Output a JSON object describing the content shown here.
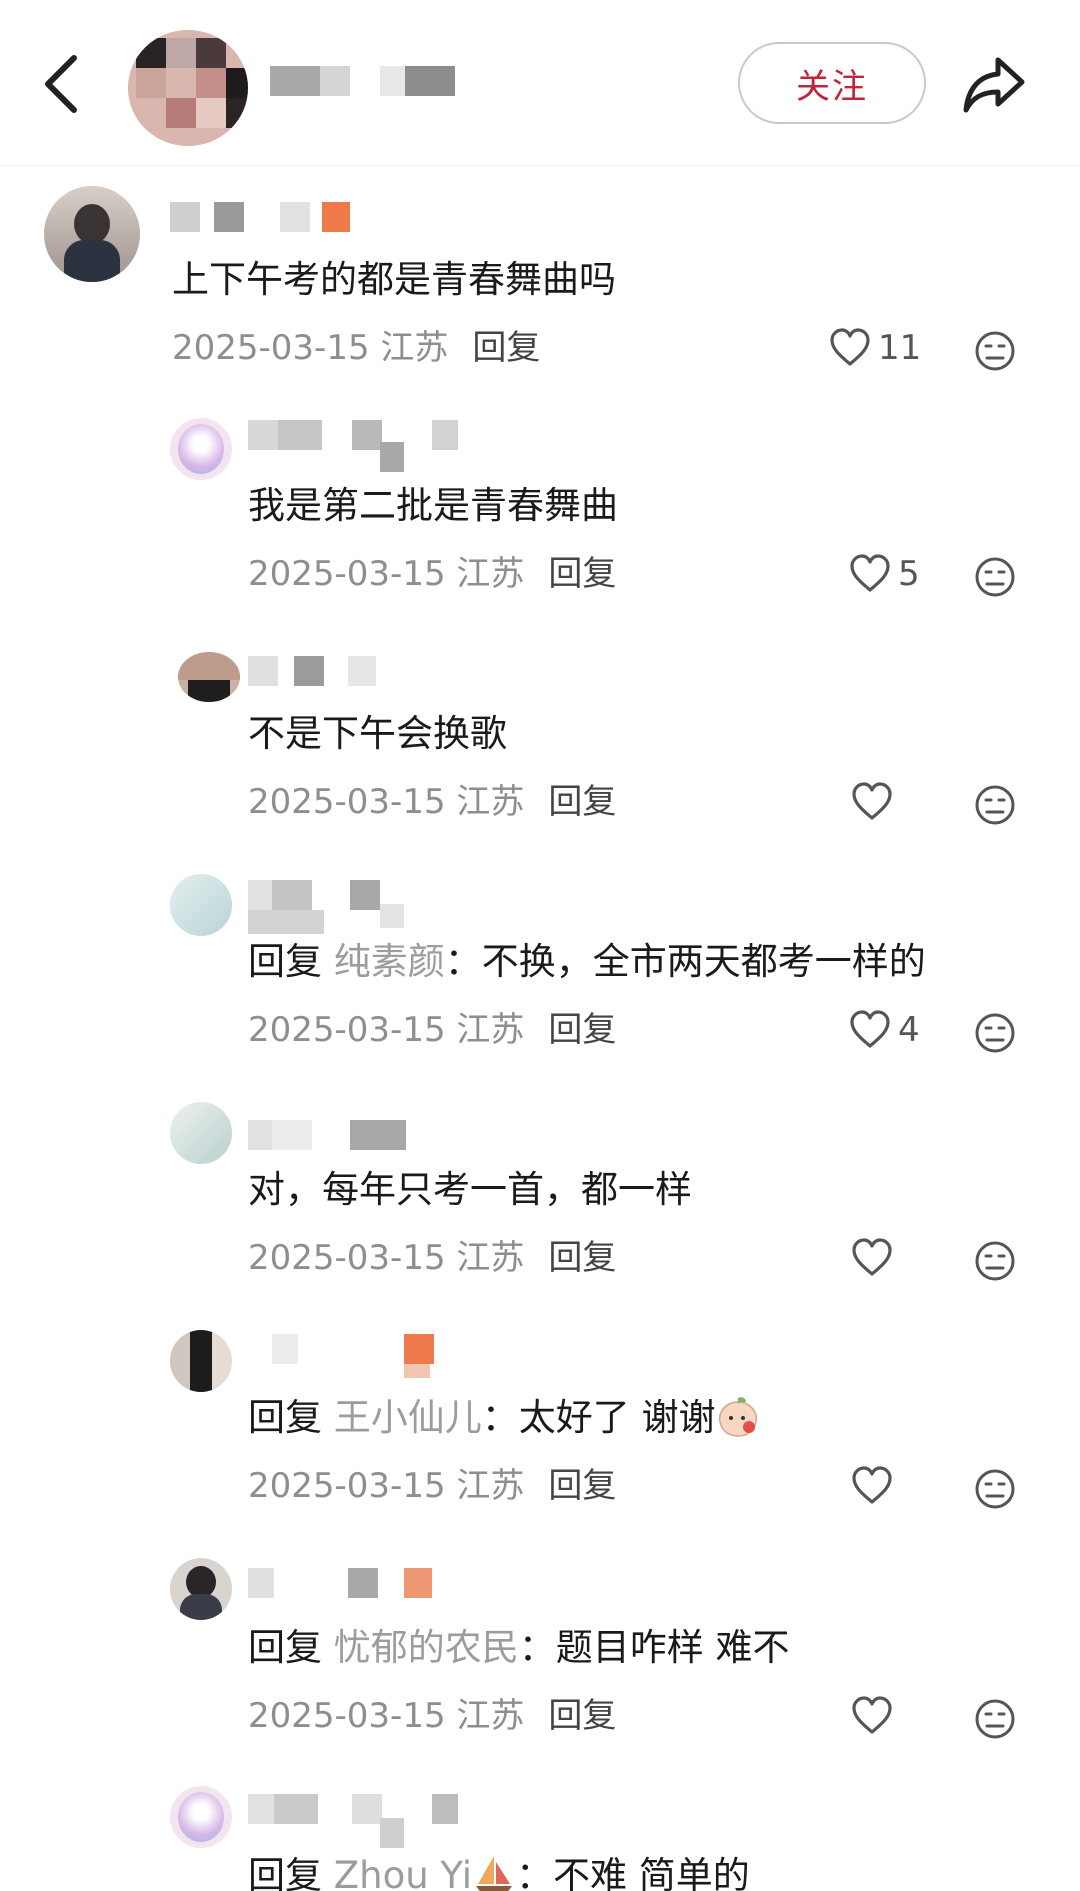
{
  "header": {
    "follow_label": "关注"
  },
  "comments": [
    {
      "text": "上下午考的都是青春舞曲吗",
      "date": "2025-03-15 江苏",
      "reply_label": "回复",
      "likes": "11"
    },
    {
      "text": "我是第二批是青春舞曲",
      "date": "2025-03-15 江苏",
      "reply_label": "回复",
      "likes": "5"
    },
    {
      "text": "不是下午会换歌",
      "date": "2025-03-15 江苏",
      "reply_label": "回复",
      "likes": ""
    },
    {
      "prefix": "回复",
      "target": "纯素颜",
      "text": "：不换，全市两天都考一样的",
      "date": "2025-03-15 江苏",
      "reply_label": "回复",
      "likes": "4"
    },
    {
      "text": "对，每年只考一首，都一样",
      "date": "2025-03-15 江苏",
      "reply_label": "回复",
      "likes": ""
    },
    {
      "prefix": "回复",
      "target": "王小仙儿",
      "text": "：太好了 谢谢",
      "date": "2025-03-15 江苏",
      "reply_label": "回复",
      "likes": ""
    },
    {
      "prefix": "回复",
      "target": "忧郁的农民",
      "text": "：题目咋样 难不",
      "date": "2025-03-15 江苏",
      "reply_label": "回复",
      "likes": ""
    },
    {
      "prefix": "回复",
      "target": "Zhou Yi",
      "text": "：不难 简单的"
    }
  ],
  "icons": {
    "back": "chevron-left-icon",
    "share": "share-arrow-icon",
    "like": "heart-outline-icon",
    "dislike": "meh-face-icon",
    "emoji": "peach-emoji-icon",
    "sailboat": "sailboat-emoji-icon"
  },
  "colors": {
    "follow_text": "#c2243a",
    "meta_text": "#8e8e8e",
    "mention_text": "#9c9c9c"
  }
}
